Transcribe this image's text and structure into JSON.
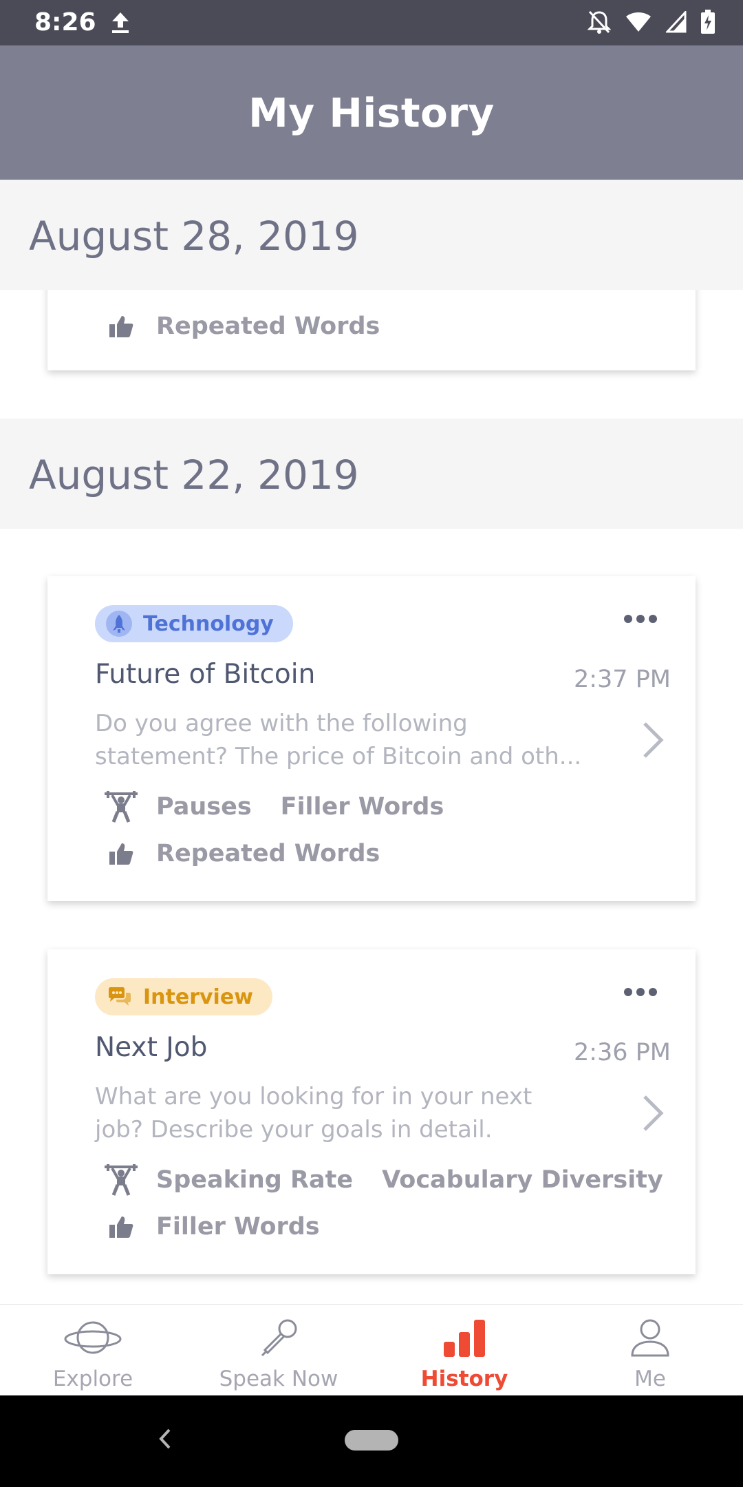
{
  "status_bar": {
    "time": "8:26"
  },
  "header": {
    "title": "My History"
  },
  "sections": [
    {
      "date": "August 28, 2019",
      "cards": [
        {
          "metrics_row2": [
            "Repeated Words"
          ]
        }
      ]
    },
    {
      "date": "August 22, 2019",
      "cards": [
        {
          "tag": "Technology",
          "title": "Future of Bitcoin",
          "time": "2:37 PM",
          "description": "Do you agree with the following statement? The price of Bitcoin and oth...",
          "metrics_row1": [
            "Pauses",
            "Filler Words"
          ],
          "metrics_row2": [
            "Repeated Words"
          ]
        },
        {
          "tag": "Interview",
          "title": "Next Job",
          "time": "2:36 PM",
          "description": "What are you looking for in your next job? Describe your goals in detail.",
          "metrics_row1": [
            "Speaking Rate",
            "Vocabulary Diversity"
          ],
          "metrics_row2": [
            "Filler Words"
          ]
        }
      ]
    }
  ],
  "tabs": [
    {
      "label": "Explore",
      "icon": "planet-icon",
      "active": false
    },
    {
      "label": "Speak Now",
      "icon": "microphone-icon",
      "active": false
    },
    {
      "label": "History",
      "icon": "bar-chart-icon",
      "active": true
    },
    {
      "label": "Me",
      "icon": "person-icon",
      "active": false
    }
  ],
  "colors": {
    "accent": "#ef4a33",
    "header_bg": "#7e7f91",
    "tech_tag": "#c9d8fb",
    "interview_tag": "#fde8c4"
  }
}
